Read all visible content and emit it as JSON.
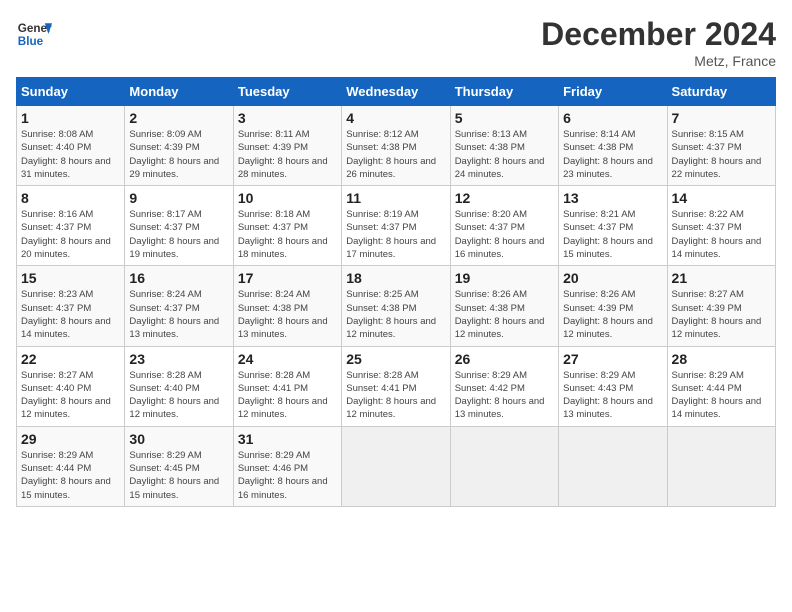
{
  "header": {
    "logo_line1": "General",
    "logo_line2": "Blue",
    "month": "December 2024",
    "location": "Metz, France"
  },
  "days_of_week": [
    "Sunday",
    "Monday",
    "Tuesday",
    "Wednesday",
    "Thursday",
    "Friday",
    "Saturday"
  ],
  "weeks": [
    [
      {
        "day": "1",
        "sunrise": "Sunrise: 8:08 AM",
        "sunset": "Sunset: 4:40 PM",
        "daylight": "Daylight: 8 hours and 31 minutes."
      },
      {
        "day": "2",
        "sunrise": "Sunrise: 8:09 AM",
        "sunset": "Sunset: 4:39 PM",
        "daylight": "Daylight: 8 hours and 29 minutes."
      },
      {
        "day": "3",
        "sunrise": "Sunrise: 8:11 AM",
        "sunset": "Sunset: 4:39 PM",
        "daylight": "Daylight: 8 hours and 28 minutes."
      },
      {
        "day": "4",
        "sunrise": "Sunrise: 8:12 AM",
        "sunset": "Sunset: 4:38 PM",
        "daylight": "Daylight: 8 hours and 26 minutes."
      },
      {
        "day": "5",
        "sunrise": "Sunrise: 8:13 AM",
        "sunset": "Sunset: 4:38 PM",
        "daylight": "Daylight: 8 hours and 24 minutes."
      },
      {
        "day": "6",
        "sunrise": "Sunrise: 8:14 AM",
        "sunset": "Sunset: 4:38 PM",
        "daylight": "Daylight: 8 hours and 23 minutes."
      },
      {
        "day": "7",
        "sunrise": "Sunrise: 8:15 AM",
        "sunset": "Sunset: 4:37 PM",
        "daylight": "Daylight: 8 hours and 22 minutes."
      }
    ],
    [
      {
        "day": "8",
        "sunrise": "Sunrise: 8:16 AM",
        "sunset": "Sunset: 4:37 PM",
        "daylight": "Daylight: 8 hours and 20 minutes."
      },
      {
        "day": "9",
        "sunrise": "Sunrise: 8:17 AM",
        "sunset": "Sunset: 4:37 PM",
        "daylight": "Daylight: 8 hours and 19 minutes."
      },
      {
        "day": "10",
        "sunrise": "Sunrise: 8:18 AM",
        "sunset": "Sunset: 4:37 PM",
        "daylight": "Daylight: 8 hours and 18 minutes."
      },
      {
        "day": "11",
        "sunrise": "Sunrise: 8:19 AM",
        "sunset": "Sunset: 4:37 PM",
        "daylight": "Daylight: 8 hours and 17 minutes."
      },
      {
        "day": "12",
        "sunrise": "Sunrise: 8:20 AM",
        "sunset": "Sunset: 4:37 PM",
        "daylight": "Daylight: 8 hours and 16 minutes."
      },
      {
        "day": "13",
        "sunrise": "Sunrise: 8:21 AM",
        "sunset": "Sunset: 4:37 PM",
        "daylight": "Daylight: 8 hours and 15 minutes."
      },
      {
        "day": "14",
        "sunrise": "Sunrise: 8:22 AM",
        "sunset": "Sunset: 4:37 PM",
        "daylight": "Daylight: 8 hours and 14 minutes."
      }
    ],
    [
      {
        "day": "15",
        "sunrise": "Sunrise: 8:23 AM",
        "sunset": "Sunset: 4:37 PM",
        "daylight": "Daylight: 8 hours and 14 minutes."
      },
      {
        "day": "16",
        "sunrise": "Sunrise: 8:24 AM",
        "sunset": "Sunset: 4:37 PM",
        "daylight": "Daylight: 8 hours and 13 minutes."
      },
      {
        "day": "17",
        "sunrise": "Sunrise: 8:24 AM",
        "sunset": "Sunset: 4:38 PM",
        "daylight": "Daylight: 8 hours and 13 minutes."
      },
      {
        "day": "18",
        "sunrise": "Sunrise: 8:25 AM",
        "sunset": "Sunset: 4:38 PM",
        "daylight": "Daylight: 8 hours and 12 minutes."
      },
      {
        "day": "19",
        "sunrise": "Sunrise: 8:26 AM",
        "sunset": "Sunset: 4:38 PM",
        "daylight": "Daylight: 8 hours and 12 minutes."
      },
      {
        "day": "20",
        "sunrise": "Sunrise: 8:26 AM",
        "sunset": "Sunset: 4:39 PM",
        "daylight": "Daylight: 8 hours and 12 minutes."
      },
      {
        "day": "21",
        "sunrise": "Sunrise: 8:27 AM",
        "sunset": "Sunset: 4:39 PM",
        "daylight": "Daylight: 8 hours and 12 minutes."
      }
    ],
    [
      {
        "day": "22",
        "sunrise": "Sunrise: 8:27 AM",
        "sunset": "Sunset: 4:40 PM",
        "daylight": "Daylight: 8 hours and 12 minutes."
      },
      {
        "day": "23",
        "sunrise": "Sunrise: 8:28 AM",
        "sunset": "Sunset: 4:40 PM",
        "daylight": "Daylight: 8 hours and 12 minutes."
      },
      {
        "day": "24",
        "sunrise": "Sunrise: 8:28 AM",
        "sunset": "Sunset: 4:41 PM",
        "daylight": "Daylight: 8 hours and 12 minutes."
      },
      {
        "day": "25",
        "sunrise": "Sunrise: 8:28 AM",
        "sunset": "Sunset: 4:41 PM",
        "daylight": "Daylight: 8 hours and 12 minutes."
      },
      {
        "day": "26",
        "sunrise": "Sunrise: 8:29 AM",
        "sunset": "Sunset: 4:42 PM",
        "daylight": "Daylight: 8 hours and 13 minutes."
      },
      {
        "day": "27",
        "sunrise": "Sunrise: 8:29 AM",
        "sunset": "Sunset: 4:43 PM",
        "daylight": "Daylight: 8 hours and 13 minutes."
      },
      {
        "day": "28",
        "sunrise": "Sunrise: 8:29 AM",
        "sunset": "Sunset: 4:44 PM",
        "daylight": "Daylight: 8 hours and 14 minutes."
      }
    ],
    [
      {
        "day": "29",
        "sunrise": "Sunrise: 8:29 AM",
        "sunset": "Sunset: 4:44 PM",
        "daylight": "Daylight: 8 hours and 15 minutes."
      },
      {
        "day": "30",
        "sunrise": "Sunrise: 8:29 AM",
        "sunset": "Sunset: 4:45 PM",
        "daylight": "Daylight: 8 hours and 15 minutes."
      },
      {
        "day": "31",
        "sunrise": "Sunrise: 8:29 AM",
        "sunset": "Sunset: 4:46 PM",
        "daylight": "Daylight: 8 hours and 16 minutes."
      },
      null,
      null,
      null,
      null
    ]
  ]
}
